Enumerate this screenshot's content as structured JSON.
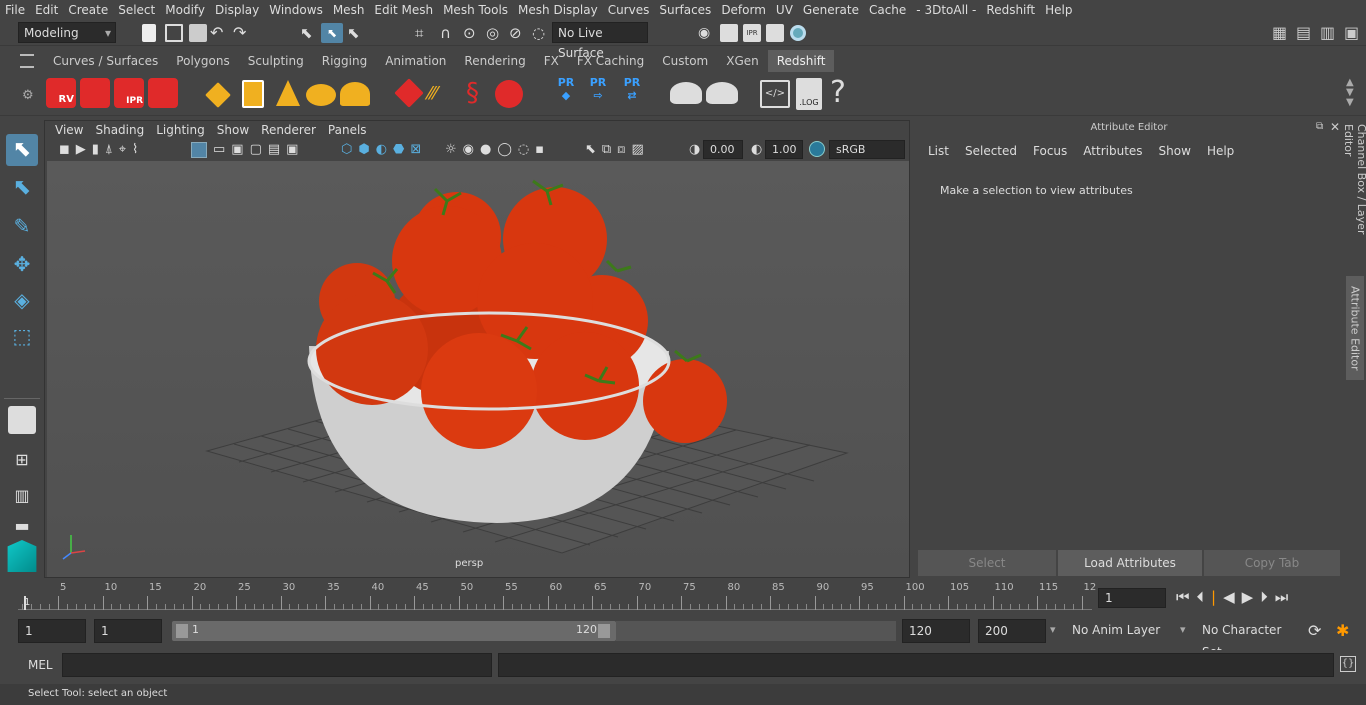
{
  "menubar": [
    "File",
    "Edit",
    "Create",
    "Select",
    "Modify",
    "Display",
    "Windows",
    "Mesh",
    "Edit Mesh",
    "Mesh Tools",
    "Mesh Display",
    "Curves",
    "Surfaces",
    "Deform",
    "UV",
    "Generate",
    "Cache",
    "- 3DtoAll -",
    "Redshift",
    "Help"
  ],
  "status": {
    "workspace": "Modeling",
    "live_surface": "No Live Surface"
  },
  "shelf_tabs": [
    "Curves / Surfaces",
    "Polygons",
    "Sculpting",
    "Rigging",
    "Animation",
    "Rendering",
    "FX",
    "FX Caching",
    "Custom",
    "XGen",
    "Redshift"
  ],
  "shelf_active": "Redshift",
  "shelf_labels": {
    "rv": "RV",
    "ipr": "IPR",
    "pr1": "PR",
    "pr2": "PR",
    "pr3": "PR",
    "log": ".LOG"
  },
  "viewport": {
    "menu": [
      "View",
      "Shading",
      "Lighting",
      "Show",
      "Renderer",
      "Panels"
    ],
    "exposure": "0.00",
    "gamma": "1.00",
    "color_space": "sRGB gamma",
    "camera_label": "persp"
  },
  "attribute_editor": {
    "title": "Attribute Editor",
    "menu": [
      "List",
      "Selected",
      "Focus",
      "Attributes",
      "Show",
      "Help"
    ],
    "message": "Make a selection to view attributes",
    "buttons": {
      "select": "Select",
      "load": "Load Attributes",
      "copy": "Copy Tab"
    }
  },
  "side_tabs": {
    "channel_box": "Channel Box / Layer Editor",
    "attribute_editor": "Attribute Editor"
  },
  "timeline": {
    "ticks": [
      "5",
      "10",
      "15",
      "20",
      "25",
      "30",
      "35",
      "40",
      "45",
      "50",
      "55",
      "60",
      "65",
      "70",
      "75",
      "80",
      "85",
      "90",
      "95",
      "100",
      "105",
      "110",
      "115",
      "12"
    ],
    "start_marker": "1",
    "current_frame": "1"
  },
  "range": {
    "start": "1",
    "anim_start": "1",
    "slider_start": "1",
    "slider_end": "120",
    "end": "120",
    "anim_end": "200",
    "anim_layer": "No Anim Layer",
    "character_set": "No Character Set"
  },
  "cmd": {
    "lang": "MEL"
  },
  "help_text": "Select Tool: select an object",
  "colors": {
    "accent": "#5285a6",
    "panel": "#444444",
    "field": "#2b2b2b",
    "tomato": "#d8370f",
    "redshift": "#e02a2a"
  }
}
